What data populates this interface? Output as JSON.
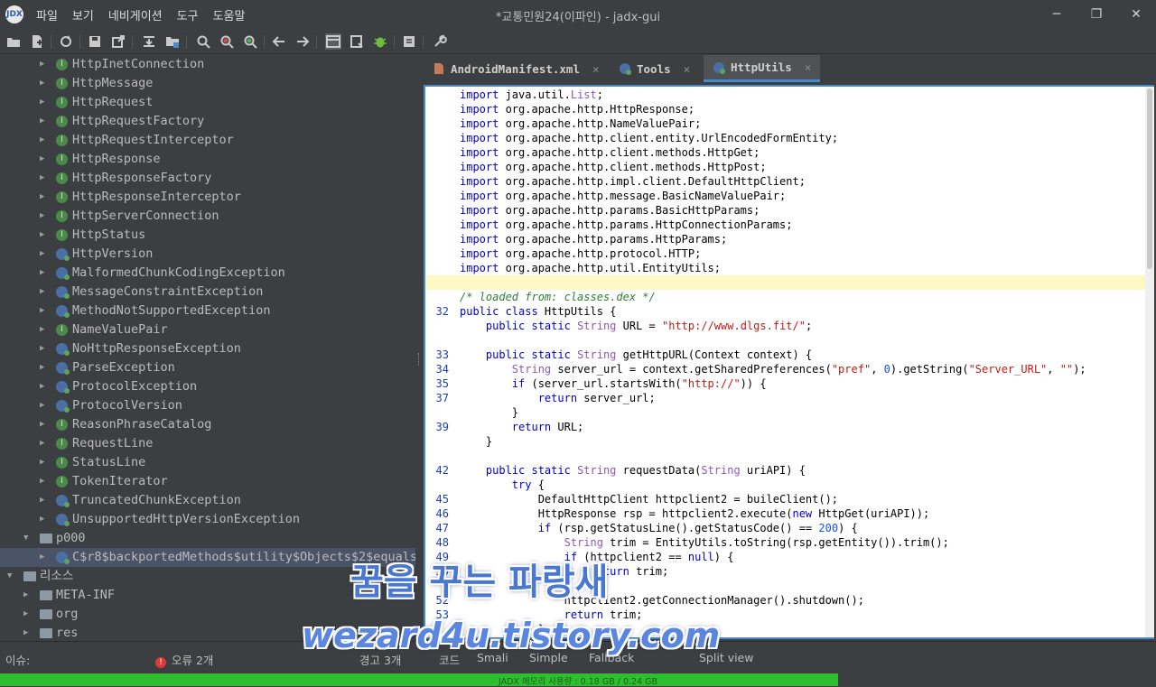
{
  "window": {
    "title": "*교통민원24(이파인) - jadx-gui",
    "logo": "JDX",
    "menu": [
      "파일",
      "보기",
      "네비게이션",
      "도구",
      "도움말"
    ],
    "controls": [
      "─",
      "❐",
      "✕"
    ]
  },
  "toolbar": {
    "icons": [
      "open-icon",
      "add-file-icon",
      "reload-icon",
      "save-icon",
      "export-icon",
      "sync-icon",
      "flatten-icon",
      "search-icon",
      "find-class-icon",
      "find-usage-icon",
      "back-icon",
      "forward-icon",
      "decompiler-icon",
      "bookmark-icon",
      "debug-icon",
      "log-icon",
      "preferences-icon"
    ]
  },
  "tree": {
    "items": [
      {
        "label": "HttpInetConnection",
        "icon": "interface"
      },
      {
        "label": "HttpMessage",
        "icon": "interface"
      },
      {
        "label": "HttpRequest",
        "icon": "interface"
      },
      {
        "label": "HttpRequestFactory",
        "icon": "interface"
      },
      {
        "label": "HttpRequestInterceptor",
        "icon": "interface"
      },
      {
        "label": "HttpResponse",
        "icon": "interface"
      },
      {
        "label": "HttpResponseFactory",
        "icon": "interface"
      },
      {
        "label": "HttpResponseInterceptor",
        "icon": "interface"
      },
      {
        "label": "HttpServerConnection",
        "icon": "interface"
      },
      {
        "label": "HttpStatus",
        "icon": "interface"
      },
      {
        "label": "HttpVersion",
        "icon": "class"
      },
      {
        "label": "MalformedChunkCodingException",
        "icon": "class"
      },
      {
        "label": "MessageConstraintException",
        "icon": "class"
      },
      {
        "label": "MethodNotSupportedException",
        "icon": "class"
      },
      {
        "label": "NameValuePair",
        "icon": "interface"
      },
      {
        "label": "NoHttpResponseException",
        "icon": "class"
      },
      {
        "label": "ParseException",
        "icon": "class"
      },
      {
        "label": "ProtocolException",
        "icon": "class"
      },
      {
        "label": "ProtocolVersion",
        "icon": "class"
      },
      {
        "label": "ReasonPhraseCatalog",
        "icon": "interface"
      },
      {
        "label": "RequestLine",
        "icon": "interface"
      },
      {
        "label": "StatusLine",
        "icon": "interface"
      },
      {
        "label": "TokenIterator",
        "icon": "interface"
      },
      {
        "label": "TruncatedChunkException",
        "icon": "class"
      },
      {
        "label": "UnsupportedHttpVersionException",
        "icon": "class"
      }
    ],
    "package": "p000",
    "selected": "C$r8$backportedMethods$utility$Objects$2$equals",
    "resources_label": "리소스",
    "resources": [
      "META-INF",
      "org",
      "res"
    ]
  },
  "tabs": [
    {
      "label": "AndroidManifest.xml",
      "icon": "xml-file-icon"
    },
    {
      "label": "Tools",
      "icon": "class-icon"
    },
    {
      "label": "HttpUtils",
      "icon": "class-icon",
      "active": true
    }
  ],
  "code_lines": [
    {
      "ln": "",
      "code": "<span class='kw'>import</span> java.util.<span class='ty'>List</span>;"
    },
    {
      "ln": "",
      "code": "<span class='kw'>import</span> org.apache.http.HttpResponse;"
    },
    {
      "ln": "",
      "code": "<span class='kw'>import</span> org.apache.http.NameValuePair;"
    },
    {
      "ln": "",
      "code": "<span class='kw'>import</span> org.apache.http.client.entity.UrlEncodedFormEntity;"
    },
    {
      "ln": "",
      "code": "<span class='kw'>import</span> org.apache.http.client.methods.HttpGet;"
    },
    {
      "ln": "",
      "code": "<span class='kw'>import</span> org.apache.http.client.methods.HttpPost;"
    },
    {
      "ln": "",
      "code": "<span class='kw'>import</span> org.apache.http.impl.client.DefaultHttpClient;"
    },
    {
      "ln": "",
      "code": "<span class='kw'>import</span> org.apache.http.message.BasicNameValuePair;"
    },
    {
      "ln": "",
      "code": "<span class='kw'>import</span> org.apache.http.params.BasicHttpParams;"
    },
    {
      "ln": "",
      "code": "<span class='kw'>import</span> org.apache.http.params.HttpConnectionParams;"
    },
    {
      "ln": "",
      "code": "<span class='kw'>import</span> org.apache.http.params.HttpParams;"
    },
    {
      "ln": "",
      "code": "<span class='kw'>import</span> org.apache.http.protocol.HTTP;"
    },
    {
      "ln": "",
      "code": "<span class='kw'>import</span> org.apache.http.util.EntityUtils;"
    },
    {
      "ln": "",
      "code": "",
      "hl": true
    },
    {
      "ln": "",
      "code": "<span class='cm'>/* loaded from: classes.dex */</span>"
    },
    {
      "ln": "32",
      "code": "<span class='kw'>public class</span> HttpUtils {"
    },
    {
      "ln": "",
      "code": "    <span class='kw'>public static</span> <span class='ty'>String</span> URL = <span class='st'>\"http://www.dlgs.fit/\"</span>;"
    },
    {
      "ln": "",
      "code": ""
    },
    {
      "ln": "33",
      "code": "    <span class='kw'>public static</span> <span class='ty'>String</span> getHttpURL(Context context) {"
    },
    {
      "ln": "34",
      "code": "        <span class='ty'>String</span> server_url = context.getSharedPreferences(<span class='st'>\"pref\"</span>, <span class='num'>0</span>).getString(<span class='st'>\"Server_URL\"</span>, <span class='st'>\"\"</span>);"
    },
    {
      "ln": "35",
      "code": "        <span class='kw'>if</span> (server_url.startsWith(<span class='st'>\"http://\"</span>)) {"
    },
    {
      "ln": "37",
      "code": "            <span class='kw'>return</span> server_url;"
    },
    {
      "ln": "",
      "code": "        }"
    },
    {
      "ln": "39",
      "code": "        <span class='kw'>return</span> URL;"
    },
    {
      "ln": "",
      "code": "    }"
    },
    {
      "ln": "",
      "code": ""
    },
    {
      "ln": "42",
      "code": "    <span class='kw'>public static</span> <span class='ty'>String</span> requestData(<span class='ty'>String</span> uriAPI) {"
    },
    {
      "ln": "",
      "code": "        <span class='kw'>try</span> {"
    },
    {
      "ln": "45",
      "code": "            DefaultHttpClient httpclient2 = buileClient();"
    },
    {
      "ln": "46",
      "code": "            HttpResponse rsp = httpclient2.execute(<span class='kw'>new</span> HttpGet(uriAPI));"
    },
    {
      "ln": "47",
      "code": "            <span class='kw'>if</span> (rsp.getStatusLine().getStatusCode() == <span class='num'>200</span>) {"
    },
    {
      "ln": "48",
      "code": "                <span class='ty'>String</span> trim = EntityUtils.toString(rsp.getEntity()).trim();"
    },
    {
      "ln": "49",
      "code": "                <span class='kw'>if</span> (httpclient2 == <span class='kw'>null</span>) {"
    },
    {
      "ln": "50",
      "code": "                    <span class='kw'>return</span> trim;"
    },
    {
      "ln": "",
      "code": "                }"
    },
    {
      "ln": "52",
      "code": "                httpclient2.getConnectionManager().shutdown();"
    },
    {
      "ln": "53",
      "code": "                <span class='kw'>return</span> trim;"
    },
    {
      "ln": "",
      "code": "            }"
    }
  ],
  "status": {
    "issues_label": "이슈:",
    "errors_label": "오류 2개",
    "warnings_label": "경고 3개",
    "code_label": "코드",
    "smali_label": "Smali",
    "simple_label": "Simple",
    "fallback_label": "Fallback",
    "split_label": "Split view"
  },
  "memory": {
    "label": "JADX 메모리 사용량 : 0.18 GB / 0.24 GB",
    "fraction": 0.725
  },
  "watermark": {
    "line1": "꿈을 꾸는 파랑새",
    "line2": "wezard4u.tistory.com"
  }
}
